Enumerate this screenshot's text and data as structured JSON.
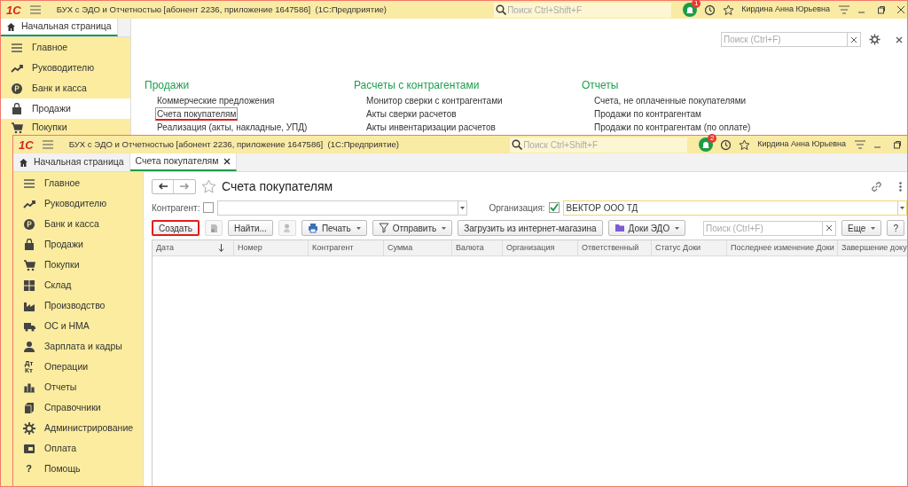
{
  "back_window": {
    "logo": "1С",
    "title": "БУХ с ЭДО и Отчетностью [абонент 2236, приложение 1647586]  (1С:Предприятие)",
    "search": {
      "placeholder": "Поиск Ctrl+Shift+F"
    },
    "notifications": "1",
    "user": "Кирдина Анна Юрьевна",
    "tabs": [
      {
        "label": "Начальная страница",
        "selected": true,
        "closable": false
      }
    ],
    "sidebar": {
      "items": [
        {
          "label": "Главное",
          "selected": false
        },
        {
          "label": "Руководителю",
          "selected": false
        },
        {
          "label": "Банк и касса",
          "selected": false
        },
        {
          "label": "Продажи",
          "selected": true
        },
        {
          "label": "Покупки",
          "selected": false
        }
      ]
    },
    "content_search": {
      "placeholder": "Поиск (Ctrl+F)"
    },
    "sections": [
      {
        "title": "Продажи",
        "links": [
          {
            "label": "Коммерческие предложения",
            "highlighted": false
          },
          {
            "label": "Счета покупателям",
            "highlighted": true
          },
          {
            "label": "Реализация (акты, накладные, УПД)",
            "highlighted": false
          }
        ]
      },
      {
        "title": "Расчеты с контрагентами",
        "links": [
          {
            "label": "Монитор сверки с контрагентами",
            "highlighted": false
          },
          {
            "label": "Акты сверки расчетов",
            "highlighted": false
          },
          {
            "label": "Акты инвентаризации расчетов",
            "highlighted": false
          }
        ]
      },
      {
        "title": "Отчеты",
        "links": [
          {
            "label": "Счета, не оплаченные покупателями",
            "highlighted": false
          },
          {
            "label": "Продажи по контрагентам",
            "highlighted": false
          },
          {
            "label": "Продажи по контрагентам (по оплате)",
            "highlighted": false
          }
        ]
      }
    ]
  },
  "front_window": {
    "logo": "1С",
    "title": "БУХ с ЭДО и Отчетностью [абонент 2236, приложение 1647586]  (1С:Предприятие)",
    "search": {
      "placeholder": "Поиск Ctrl+Shift+F"
    },
    "notifications": "2",
    "user": "Кирдина Анна Юрьевна",
    "tabs": [
      {
        "label": "Начальная страница",
        "selected": false,
        "closable": false
      },
      {
        "label": "Счета покупателям",
        "selected": true,
        "closable": true
      }
    ],
    "sidebar": {
      "items": [
        {
          "label": "Главное",
          "selected": false
        },
        {
          "label": "Руководителю",
          "selected": false
        },
        {
          "label": "Банк и касса",
          "selected": false
        },
        {
          "label": "Продажи",
          "selected": false
        },
        {
          "label": "Покупки",
          "selected": false
        },
        {
          "label": "Склад",
          "selected": false
        },
        {
          "label": "Производство",
          "selected": false
        },
        {
          "label": "ОС и НМА",
          "selected": false
        },
        {
          "label": "Зарплата и кадры",
          "selected": false
        },
        {
          "label": "Операции",
          "selected": false,
          "icon_text": "Дт Кт"
        },
        {
          "label": "Отчеты",
          "selected": false
        },
        {
          "label": "Справочники",
          "selected": false
        },
        {
          "label": "Администрирование",
          "selected": false
        },
        {
          "label": "Оплата",
          "selected": false
        },
        {
          "label": "Помощь",
          "selected": false,
          "icon_text": "?"
        }
      ]
    },
    "form": {
      "title": "Счета покупателям",
      "filters": [
        {
          "label": "Контрагент:",
          "checked": false
        },
        {
          "label": "Организация:",
          "checked": true,
          "value": "ВЕКТОР ООО ТД"
        }
      ],
      "toolbar": [
        {
          "kind": "button",
          "label": "Создать",
          "highlighted": true
        },
        {
          "kind": "icon"
        },
        {
          "kind": "button",
          "label": "Найти...",
          "highlighted": false
        },
        {
          "kind": "icon"
        },
        {
          "kind": "menu",
          "label": "Печать",
          "highlighted": false
        },
        {
          "kind": "menu",
          "label": "Отправить",
          "highlighted": false
        },
        {
          "kind": "button",
          "label": "Загрузить из интернет-магазина",
          "highlighted": false
        },
        {
          "kind": "menu",
          "label": "Доки ЭДО",
          "highlighted": false
        }
      ],
      "search": {
        "placeholder": "Поиск (Ctrl+F)"
      },
      "more": "Еще",
      "help": "?",
      "columns": [
        {
          "label": "Дата",
          "sorted": true
        },
        {
          "label": "Номер",
          "sorted": false
        },
        {
          "label": "Контрагент",
          "sorted": false
        },
        {
          "label": "Сумма",
          "sorted": false
        },
        {
          "label": "Валюта",
          "sorted": false
        },
        {
          "label": "Организация",
          "sorted": false
        },
        {
          "label": "Ответственный",
          "sorted": false
        },
        {
          "label": "Статус Доки",
          "sorted": false
        },
        {
          "label": "Последнее изменение Доки",
          "sorted": false
        },
        {
          "label": "Завершение доку",
          "sorted": false
        }
      ]
    }
  }
}
